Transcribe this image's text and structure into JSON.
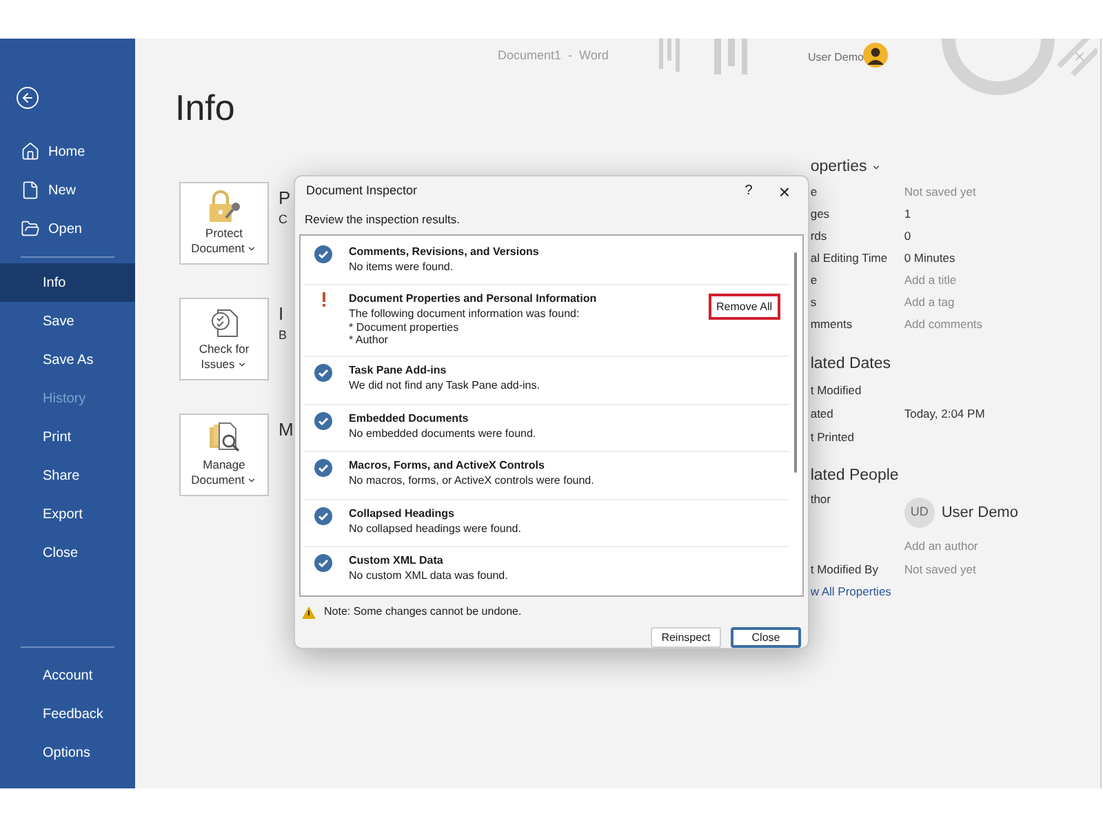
{
  "window": {
    "title": "Document1  -  Word",
    "user": "User Demo"
  },
  "sidebar": {
    "items": [
      {
        "label": "Home",
        "selected": false,
        "disabled": false
      },
      {
        "label": "New",
        "selected": false,
        "disabled": false
      },
      {
        "label": "Open",
        "selected": false,
        "disabled": false
      },
      {
        "label": "Info",
        "selected": true,
        "disabled": false
      },
      {
        "label": "Save",
        "selected": false,
        "disabled": false
      },
      {
        "label": "Save As",
        "selected": false,
        "disabled": false
      },
      {
        "label": "History",
        "selected": false,
        "disabled": true
      },
      {
        "label": "Print",
        "selected": false,
        "disabled": false
      },
      {
        "label": "Share",
        "selected": false,
        "disabled": false
      },
      {
        "label": "Export",
        "selected": false,
        "disabled": false
      },
      {
        "label": "Close",
        "selected": false,
        "disabled": false
      }
    ],
    "bottom_items": [
      {
        "label": "Account"
      },
      {
        "label": "Feedback"
      },
      {
        "label": "Options"
      }
    ]
  },
  "page_title": "Info",
  "sections": [
    {
      "button": {
        "line1": "Protect",
        "line2": "Document"
      },
      "heading": "P",
      "subtext": "C"
    },
    {
      "button": {
        "line1": "Check for",
        "line2": "Issues"
      },
      "heading": "I",
      "subtext": "B"
    },
    {
      "button": {
        "line1": "Manage",
        "line2": "Document"
      },
      "heading": "M"
    }
  ],
  "properties": {
    "heading": "operties",
    "rows": [
      {
        "label": "e",
        "value": "Not saved yet",
        "kind": "muted"
      },
      {
        "label": "ges",
        "value": "1",
        "kind": "plain"
      },
      {
        "label": "rds",
        "value": "0",
        "kind": "plain"
      },
      {
        "label": "al Editing Time",
        "value": "0 Minutes",
        "kind": "plain"
      },
      {
        "label": "e",
        "value": "Add a title",
        "kind": "muted"
      },
      {
        "label": "s",
        "value": "Add a tag",
        "kind": "muted"
      },
      {
        "label": "mments",
        "value": "Add comments",
        "kind": "muted"
      }
    ]
  },
  "related_dates": {
    "heading": "lated Dates",
    "rows": [
      {
        "label": "t Modified"
      },
      {
        "label": "ated",
        "value": "Today, 2:04 PM"
      },
      {
        "label": "t Printed"
      }
    ]
  },
  "related_people": {
    "heading": "lated People",
    "author_label": "thor",
    "author_initials": "UD",
    "author_name": "User Demo",
    "add_author": "Add an author",
    "modified_by_label": "t Modified By",
    "modified_by_value": "Not saved yet",
    "link": "w All Properties"
  },
  "dialog": {
    "title": "Document Inspector",
    "help": "?",
    "close": "×",
    "instruction": "Review the inspection results.",
    "results": [
      {
        "kind": "passed",
        "title": "Comments, Revisions, and Versions",
        "lines": [
          "No items were found."
        ]
      },
      {
        "kind": "found",
        "title": "Document Properties and Personal Information",
        "lines": [
          "The following document information was found:",
          "* Document properties",
          "* Author"
        ],
        "action": "Remove All",
        "highlighted": true
      },
      {
        "kind": "passed",
        "title": "Task Pane Add-ins",
        "lines": [
          "We did not find any Task Pane add-ins."
        ]
      },
      {
        "kind": "passed",
        "title": "Embedded Documents",
        "lines": [
          "No embedded documents were found."
        ]
      },
      {
        "kind": "passed",
        "title": "Macros, Forms, and ActiveX Controls",
        "lines": [
          "No macros, forms, or ActiveX controls were found."
        ]
      },
      {
        "kind": "passed",
        "title": "Collapsed Headings",
        "lines": [
          "No collapsed headings were found."
        ]
      },
      {
        "kind": "passed",
        "title": "Custom XML Data",
        "lines": [
          "No custom XML data was found."
        ]
      }
    ],
    "note": "Note: Some changes cannot be undone.",
    "buttons": [
      {
        "label": "Reinspect",
        "default": false
      },
      {
        "label": "Close",
        "default": true
      }
    ]
  }
}
